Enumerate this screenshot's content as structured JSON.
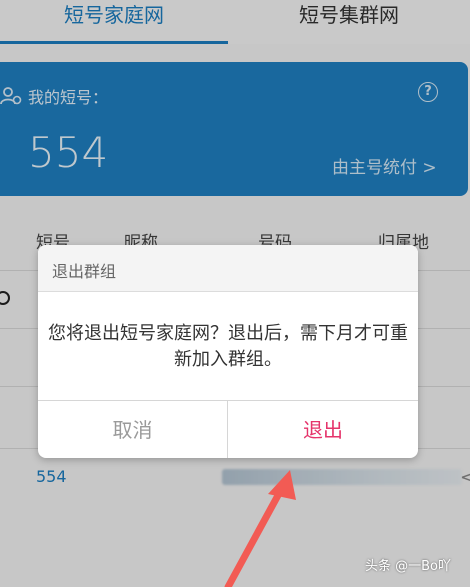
{
  "tabs": [
    {
      "label": "短号家庭网",
      "active": true
    },
    {
      "label": "短号集群网",
      "active": false
    }
  ],
  "card": {
    "label": "我的短号：",
    "number": "554",
    "stats_link": "由主号统付 >",
    "help_glyph": "?"
  },
  "table": {
    "headers": [
      "短号",
      "昵称",
      "号码",
      "归属地"
    ],
    "rows": [
      {
        "code": ""
      },
      {
        "code": ""
      },
      {
        "code": ""
      },
      {
        "code": "554"
      }
    ]
  },
  "dialog": {
    "title": "退出群组",
    "message": "您将退出短号家庭网？退出后，需下月才可重新加入群组。",
    "cancel_label": "取消",
    "confirm_label": "退出"
  },
  "watermark": "头条 @一Bo吖",
  "colors": {
    "accent": "#1b7dc0",
    "card_bg": "#1f7fc1",
    "confirm": "#e5346b",
    "arrow": "#f25b54"
  }
}
